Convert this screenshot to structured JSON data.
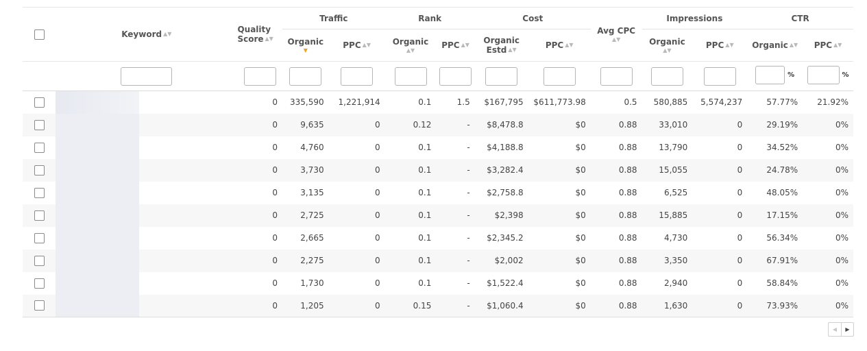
{
  "headers": {
    "keyword": "Keyword",
    "quality_score_line1": "Quality",
    "quality_score_line2": "Score",
    "traffic": "Traffic",
    "rank": "Rank",
    "cost": "Cost",
    "avg_cpc": "Avg CPC",
    "impressions": "Impressions",
    "ctr": "CTR",
    "organic": "Organic",
    "ppc": "PPC",
    "organic_estd_line1": "Organic",
    "organic_estd_line2": "Estd"
  },
  "sort_icon": "sort-arrows-icon",
  "active_sort_icon": "sort-desc-icon",
  "percent_symbol": "%",
  "rows": [
    {
      "qs": "0",
      "traffic_org": "335,590",
      "traffic_ppc": "1,221,914",
      "rank_org": "0.1",
      "rank_ppc": "1.5",
      "cost_org": "$167,795",
      "cost_ppc": "$611,773.98",
      "avg_cpc": "0.5",
      "imp_org": "580,885",
      "imp_ppc": "5,574,237",
      "ctr_org": "57.77%",
      "ctr_ppc": "21.92%"
    },
    {
      "qs": "0",
      "traffic_org": "9,635",
      "traffic_ppc": "0",
      "rank_org": "0.12",
      "rank_ppc": "-",
      "cost_org": "$8,478.8",
      "cost_ppc": "$0",
      "avg_cpc": "0.88",
      "imp_org": "33,010",
      "imp_ppc": "0",
      "ctr_org": "29.19%",
      "ctr_ppc": "0%"
    },
    {
      "qs": "0",
      "traffic_org": "4,760",
      "traffic_ppc": "0",
      "rank_org": "0.1",
      "rank_ppc": "-",
      "cost_org": "$4,188.8",
      "cost_ppc": "$0",
      "avg_cpc": "0.88",
      "imp_org": "13,790",
      "imp_ppc": "0",
      "ctr_org": "34.52%",
      "ctr_ppc": "0%"
    },
    {
      "qs": "0",
      "traffic_org": "3,730",
      "traffic_ppc": "0",
      "rank_org": "0.1",
      "rank_ppc": "-",
      "cost_org": "$3,282.4",
      "cost_ppc": "$0",
      "avg_cpc": "0.88",
      "imp_org": "15,055",
      "imp_ppc": "0",
      "ctr_org": "24.78%",
      "ctr_ppc": "0%"
    },
    {
      "qs": "0",
      "traffic_org": "3,135",
      "traffic_ppc": "0",
      "rank_org": "0.1",
      "rank_ppc": "-",
      "cost_org": "$2,758.8",
      "cost_ppc": "$0",
      "avg_cpc": "0.88",
      "imp_org": "6,525",
      "imp_ppc": "0",
      "ctr_org": "48.05%",
      "ctr_ppc": "0%"
    },
    {
      "qs": "0",
      "traffic_org": "2,725",
      "traffic_ppc": "0",
      "rank_org": "0.1",
      "rank_ppc": "-",
      "cost_org": "$2,398",
      "cost_ppc": "$0",
      "avg_cpc": "0.88",
      "imp_org": "15,885",
      "imp_ppc": "0",
      "ctr_org": "17.15%",
      "ctr_ppc": "0%"
    },
    {
      "qs": "0",
      "traffic_org": "2,665",
      "traffic_ppc": "0",
      "rank_org": "0.1",
      "rank_ppc": "-",
      "cost_org": "$2,345.2",
      "cost_ppc": "$0",
      "avg_cpc": "0.88",
      "imp_org": "4,730",
      "imp_ppc": "0",
      "ctr_org": "56.34%",
      "ctr_ppc": "0%"
    },
    {
      "qs": "0",
      "traffic_org": "2,275",
      "traffic_ppc": "0",
      "rank_org": "0.1",
      "rank_ppc": "-",
      "cost_org": "$2,002",
      "cost_ppc": "$0",
      "avg_cpc": "0.88",
      "imp_org": "3,350",
      "imp_ppc": "0",
      "ctr_org": "67.91%",
      "ctr_ppc": "0%"
    },
    {
      "qs": "0",
      "traffic_org": "1,730",
      "traffic_ppc": "0",
      "rank_org": "0.1",
      "rank_ppc": "-",
      "cost_org": "$1,522.4",
      "cost_ppc": "$0",
      "avg_cpc": "0.88",
      "imp_org": "2,940",
      "imp_ppc": "0",
      "ctr_org": "58.84%",
      "ctr_ppc": "0%"
    },
    {
      "qs": "0",
      "traffic_org": "1,205",
      "traffic_ppc": "0",
      "rank_org": "0.15",
      "rank_ppc": "-",
      "cost_org": "$1,060.4",
      "cost_ppc": "$0",
      "avg_cpc": "0.88",
      "imp_org": "1,630",
      "imp_ppc": "0",
      "ctr_org": "73.93%",
      "ctr_ppc": "0%"
    }
  ],
  "pager": {
    "prev_icon": "chevron-left-icon",
    "next_icon": "chevron-right-icon"
  },
  "colors": {
    "active_sort": "#f0a020",
    "row_alt": "#f7f7f7",
    "border": "#e6e6e6"
  }
}
